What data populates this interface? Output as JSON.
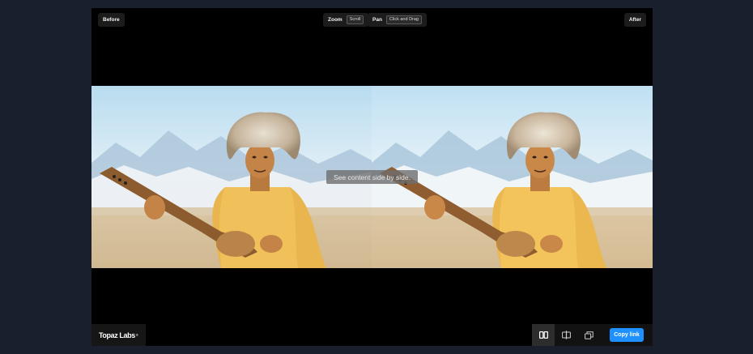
{
  "toolbar": {
    "before_label": "Before",
    "after_label": "After",
    "zoom_label": "Zoom",
    "zoom_hint": "Scroll",
    "pan_label": "Pan",
    "pan_hint": "Click and Drag"
  },
  "overlay": {
    "tooltip": "See content side by side."
  },
  "footer": {
    "brand": "Topaz Labs",
    "brand_mark": "®",
    "copy_link_label": "Copy link",
    "modes": [
      "side-by-side",
      "slider",
      "overlay"
    ],
    "active_mode": "side-by-side"
  },
  "colors": {
    "page_bg": "#1a1f2e",
    "viewer_bg": "#000000",
    "accent": "#1e90ff"
  }
}
